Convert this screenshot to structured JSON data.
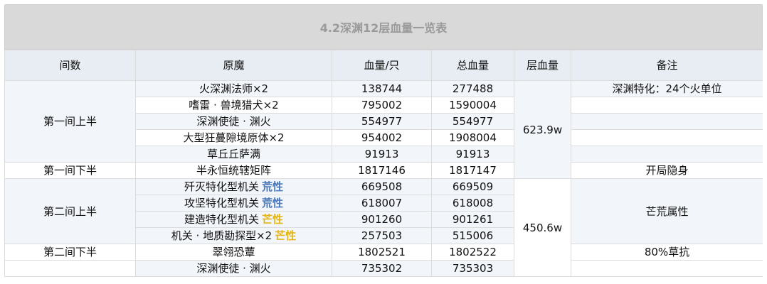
{
  "title": "4.2深渊12层血量一览表",
  "headers": [
    "间数",
    "原魔",
    "血量/只",
    "总血量",
    "层血量",
    "备注"
  ],
  "colors": {
    "tag_blue": "#4a78b8",
    "tag_yellow": "#e2b61a",
    "header_bg": "#e8edf4",
    "row_bg": "#f2f5fa"
  },
  "rows": [
    {
      "room": "第一间上半",
      "monster": "火深渊法师×2",
      "tag": "",
      "hp_each": "138744",
      "hp_total": "277488",
      "layer_hp": "623.9w",
      "note": "深渊特化：24个火单位"
    },
    {
      "room": "",
      "monster": "嗜雷 · 兽境猎犬×2",
      "tag": "",
      "hp_each": "795002",
      "hp_total": "1590004",
      "layer_hp": "",
      "note": ""
    },
    {
      "room": "",
      "monster": "深渊使徒 · 渊火",
      "tag": "",
      "hp_each": "554977",
      "hp_total": "554977",
      "layer_hp": "",
      "note": ""
    },
    {
      "room": "",
      "monster": "大型狂蔓隙境原体×2",
      "tag": "",
      "hp_each": "954002",
      "hp_total": "1908004",
      "layer_hp": "",
      "note": ""
    },
    {
      "room": "",
      "monster": "草丘丘萨满",
      "tag": "",
      "hp_each": "91913",
      "hp_total": "91913",
      "layer_hp": "",
      "note": ""
    },
    {
      "room": "第一间下半",
      "monster": "半永恒统辖矩阵",
      "tag": "",
      "hp_each": "1817146",
      "hp_total": "1817147",
      "layer_hp": "",
      "note": "开局隐身"
    },
    {
      "room": "第二间上半",
      "monster": "歼灭特化型机关",
      "tag": "荒性",
      "hp_each": "669508",
      "hp_total": "669509",
      "layer_hp": "450.6w",
      "note": "芒荒属性"
    },
    {
      "room": "",
      "monster": "攻坚特化型机关",
      "tag": "荒性",
      "hp_each": "618007",
      "hp_total": "618008",
      "layer_hp": "",
      "note": ""
    },
    {
      "room": "",
      "monster": "建造特化型机关",
      "tag": "芒性",
      "hp_each": "901260",
      "hp_total": "901261",
      "layer_hp": "",
      "note": ""
    },
    {
      "room": "",
      "monster": "机关 · 地质勘探型×2",
      "tag": "芒性",
      "hp_each": "257503",
      "hp_total": "515006",
      "layer_hp": "",
      "note": ""
    },
    {
      "room": "第二间下半",
      "monster": "翠翎恐蕈",
      "tag": "",
      "hp_each": "1802521",
      "hp_total": "1802522",
      "layer_hp": "",
      "note": "80%草抗"
    },
    {
      "room": "",
      "monster": "深渊使徒 · 渊火",
      "tag": "",
      "hp_each": "735302",
      "hp_total": "735303",
      "layer_hp": "",
      "note": ""
    }
  ]
}
